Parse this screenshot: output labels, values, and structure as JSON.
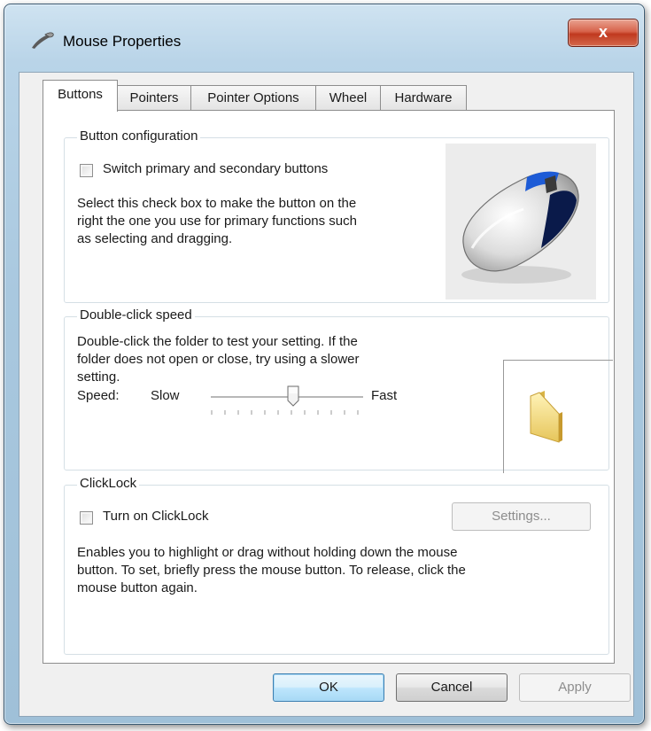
{
  "window": {
    "title": "Mouse Properties",
    "close_label": "x"
  },
  "tabs": [
    {
      "label": "Buttons",
      "active": true
    },
    {
      "label": "Pointers",
      "active": false
    },
    {
      "label": "Pointer Options",
      "active": false
    },
    {
      "label": "Wheel",
      "active": false
    },
    {
      "label": "Hardware",
      "active": false
    }
  ],
  "button_config": {
    "title": "Button configuration",
    "checkbox_label": "Switch primary and secondary buttons",
    "checked": false,
    "description": [
      "Select this check box to make the button on the",
      "right the one you use for primary functions such",
      "as selecting and dragging."
    ]
  },
  "double_click": {
    "title": "Double-click speed",
    "description": [
      "Double-click the folder to test your setting. If the",
      "folder does not open or close, try using a slower",
      "setting."
    ],
    "speed_label": "Speed:",
    "slow_label": "Slow",
    "fast_label": "Fast",
    "slider_position": 0.54
  },
  "clicklock": {
    "title": "ClickLock",
    "checkbox_label": "Turn on ClickLock",
    "checked": false,
    "settings_label": "Settings...",
    "description": [
      "Enables you to highlight or drag without holding down the mouse",
      "button. To set, briefly press the mouse button. To release, click the",
      "mouse button again."
    ]
  },
  "footer": {
    "ok_label": "OK",
    "cancel_label": "Cancel",
    "apply_label": "Apply"
  },
  "colors": {
    "accent": "#3c7fb1",
    "close": "#c0391f",
    "mouse_blue": "#1d5bd6"
  }
}
